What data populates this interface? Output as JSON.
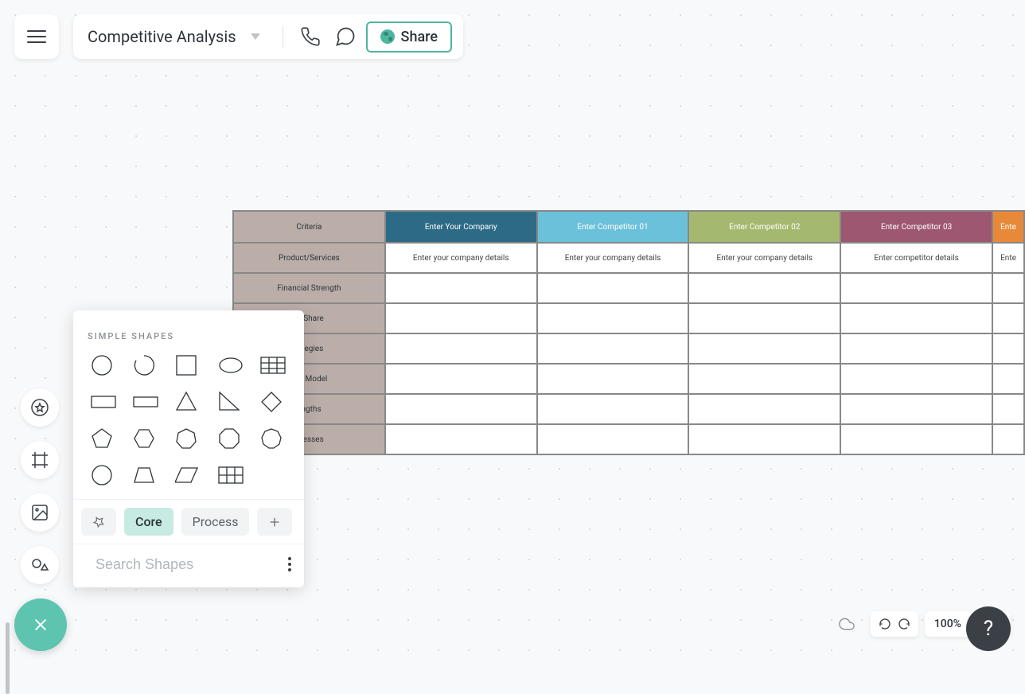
{
  "header": {
    "title": "Competitive Analysis",
    "share_label": "Share"
  },
  "shapes_panel": {
    "title": "SIMPLE SHAPES",
    "tabs": {
      "core": "Core",
      "process": "Process"
    },
    "search_placeholder": "Search Shapes",
    "shapes": [
      "circle",
      "arc",
      "square",
      "ellipse",
      "table",
      "rectangle",
      "wide-rect",
      "triangle",
      "right-triangle",
      "diamond",
      "pentagon",
      "hexagon",
      "heptagon",
      "octagon",
      "nonagon",
      "circle-outline",
      "trapezoid",
      "parallelogram",
      "grid"
    ]
  },
  "table": {
    "headers": [
      {
        "label": "Criteria",
        "bg": "#bbaea9"
      },
      {
        "label": "Enter Your Company",
        "bg": "#2d6a85"
      },
      {
        "label": "Enter Competitor 01",
        "bg": "#6bc0da"
      },
      {
        "label": "Enter Competitor 02",
        "bg": "#a4b86f"
      },
      {
        "label": "Enter Competitor 03",
        "bg": "#9d5770"
      },
      {
        "label": "Ente",
        "bg": "#e8893a"
      }
    ],
    "rows": [
      {
        "label": "Product/Services",
        "cells": [
          "Enter your company details",
          "Enter your company details",
          "Enter your company details",
          "Enter competitor details",
          "Ente"
        ]
      },
      {
        "label": "Financial Strength",
        "cells": [
          "",
          "",
          "",
          "",
          ""
        ]
      },
      {
        "label": "et Share",
        "cells": [
          "",
          "",
          "",
          "",
          ""
        ]
      },
      {
        "label": "rategies",
        "cells": [
          "",
          "",
          "",
          "",
          ""
        ]
      },
      {
        "label": "ess Model",
        "cells": [
          "",
          "",
          "",
          "",
          ""
        ]
      },
      {
        "label": "engths",
        "cells": [
          "",
          "",
          "",
          "",
          ""
        ]
      },
      {
        "label": "knesses",
        "cells": [
          "",
          "",
          "",
          "",
          ""
        ]
      }
    ]
  },
  "bottom": {
    "zoom": "100%"
  }
}
